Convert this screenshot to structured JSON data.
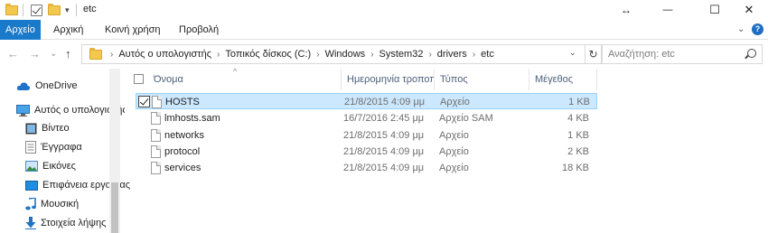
{
  "window": {
    "title": "etc",
    "controls": {
      "resize": "↔",
      "minimize": "—",
      "maximize": "☐",
      "close": "✕"
    }
  },
  "ribbon": {
    "tabs": [
      {
        "label": "Αρχείο",
        "active": true
      },
      {
        "label": "Αρχική",
        "active": false
      },
      {
        "label": "Κοινή χρήση",
        "active": false
      },
      {
        "label": "Προβολή",
        "active": false
      }
    ],
    "expand": "⌄",
    "help": "?"
  },
  "navigation": {
    "back": "←",
    "forward": "→",
    "recent": "⌄",
    "up": "↑",
    "breadcrumbs": [
      "Αυτός ο υπολογιστής",
      "Τοπικός δίσκος (C:)",
      "Windows",
      "System32",
      "drivers",
      "etc"
    ],
    "separator": "›",
    "refresh": "↻",
    "dropdown": "⌄"
  },
  "search": {
    "placeholder": "Αναζήτηση: etc"
  },
  "nav_pane": {
    "items": [
      {
        "label": "OneDrive",
        "icon": "cloud-icon"
      },
      {
        "label": "Αυτός ο υπολογιστής",
        "icon": "computer-icon"
      },
      {
        "label": "Βίντεο",
        "icon": "video-icon"
      },
      {
        "label": "Έγγραφα",
        "icon": "documents-icon"
      },
      {
        "label": "Εικόνες",
        "icon": "pictures-icon"
      },
      {
        "label": "Επιφάνεια εργασίας",
        "icon": "desktop-icon"
      },
      {
        "label": "Μουσική",
        "icon": "music-icon"
      },
      {
        "label": "Στοιχεία λήψης",
        "icon": "downloads-icon"
      }
    ]
  },
  "columns": {
    "name": "Όνομα",
    "date": "Ημερομηνία τροποποίησης",
    "type": "Τύπος",
    "size": "Μέγεθος",
    "sort_indicator": "^"
  },
  "files": [
    {
      "name": "HOSTS",
      "date": "21/8/2015 4:09 μμ",
      "type": "Αρχείο",
      "size": "1 KB",
      "selected": true
    },
    {
      "name": "lmhosts.sam",
      "date": "16/7/2016 2:45 μμ",
      "type": "Αρχείο SAM",
      "size": "4 KB",
      "selected": false
    },
    {
      "name": "networks",
      "date": "21/8/2015 4:09 μμ",
      "type": "Αρχείο",
      "size": "1 KB",
      "selected": false
    },
    {
      "name": "protocol",
      "date": "21/8/2015 4:09 μμ",
      "type": "Αρχείο",
      "size": "2 KB",
      "selected": false
    },
    {
      "name": "services",
      "date": "21/8/2015 4:09 μμ",
      "type": "Αρχείο",
      "size": "18 KB",
      "selected": false
    }
  ],
  "colors": {
    "accent": "#1979ca",
    "selection_bg": "#cce8ff",
    "selection_border": "#99d1ff",
    "folder": "#f2c94c"
  }
}
